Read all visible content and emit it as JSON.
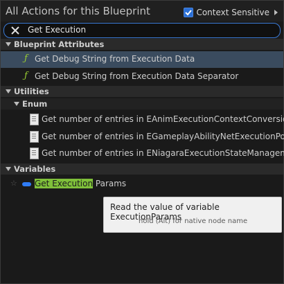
{
  "header": {
    "title": "All Actions for this Blueprint",
    "context_sensitive_label": "Context Sensitive"
  },
  "search": {
    "value": "Get Execution"
  },
  "categories": [
    {
      "label": "Blueprint Attributes",
      "items": [
        "Get Debug String from Execution Data",
        "Get Debug String from Execution Data Separator"
      ]
    },
    {
      "label": "Utilities",
      "subcategory": "Enum",
      "items": [
        "Get number of entries in EAnimExecutionContextConversionI",
        "Get number of entries in EGameplayAbilityNetExecutionPolic",
        "Get number of entries in ENiagaraExecutionStateManageme"
      ]
    },
    {
      "label": "Variables",
      "item": {
        "highlight": "Get Execution",
        "rest": " Params"
      }
    }
  ],
  "tooltip": {
    "main": "Read the value of variable ExecutionParams",
    "sub": "hold (Alt) for native node name"
  },
  "colors": {
    "accent_blue": "#2a6fd6",
    "function_green": "#9acd32",
    "variable_blue": "#2f7cf6",
    "highlight_green": "#7fc03a"
  }
}
